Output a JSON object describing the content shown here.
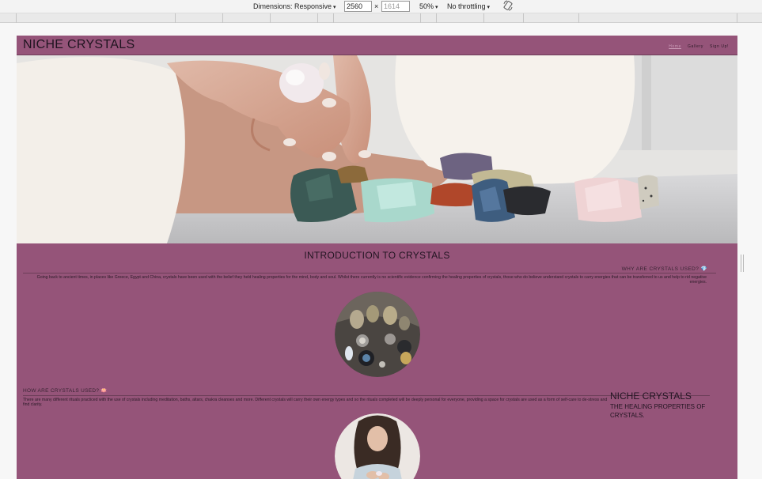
{
  "devtools": {
    "dimensions_label": "Dimensions: Responsive",
    "width_value": "2560",
    "height_placeholder": "1614",
    "times_sign": "×",
    "zoom_label": "50%",
    "throttle_label": "No throttling",
    "caret": "▾",
    "rotate_icon": "rotate-icon"
  },
  "site": {
    "logo": "NICHE CRYSTALS",
    "nav": [
      "Home",
      "Gallery",
      "Sign Up!"
    ],
    "section_title": "INTRODUCTION TO CRYSTALS",
    "why_heading": "WHY ARE CRYSTALS USED? 💎",
    "why_text": "Going back to ancient times, in places like Greece, Egypt and China, crystals have been used with the belief they held healing properties for the mind, body and soul. Whilst there currently is no scientific evidence confirming the healing properties of crystals, those who do believe understand crystals to carry energies that can be transferred to us and help to rid negative energies.",
    "how_heading": "HOW ARE CRYSTALS USED? 🪷",
    "how_text": "There are many different rituals practiced with the use of crystals including meditation, baths, altars, chakra cleanses and more. Different crystals will carry their own energy types and so the rituals completed will be deeply personal for everyone, providing a space for crystals are used as a form of self-care to de-stress and find clarity.",
    "side_title": "NICHE CRYSTALS",
    "side_subtitle": "THE HEALING PROPERTIES OF CRYSTALS."
  },
  "colors": {
    "brand_mauve": "#955479",
    "text_dark": "#221522"
  }
}
